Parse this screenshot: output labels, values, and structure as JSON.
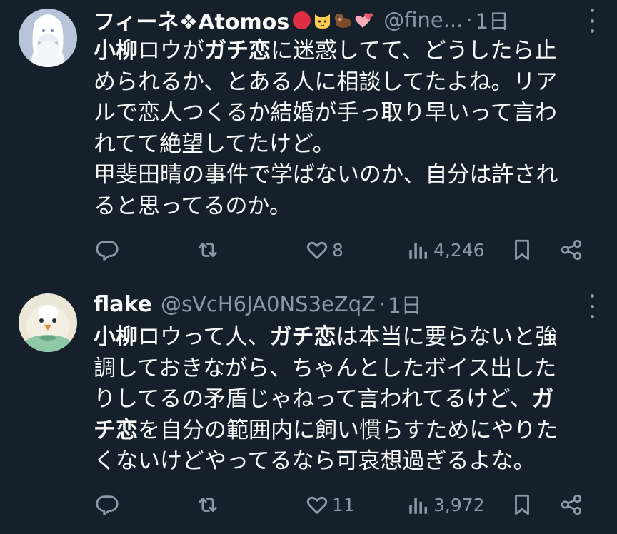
{
  "tweets": [
    {
      "name": "フィーネ❖Atomos",
      "emojis": [
        "red-circle-emoji",
        "cat-face-emoji",
        "otter-emoji",
        "two-hearts-emoji"
      ],
      "handle": "@fine...",
      "separator": "·",
      "time": "1日",
      "lines": [
        [
          {
            "t": "小柳",
            "b": true
          },
          {
            "t": "ロウが",
            "b": false
          },
          {
            "t": "ガチ恋",
            "b": true
          },
          {
            "t": "に迷惑してて、どうしたら止",
            "b": false
          }
        ],
        [
          {
            "t": "められるか、とある人に相談してたよね。リア",
            "b": false
          }
        ],
        [
          {
            "t": "ルで恋人つくるか結婚が手っ取り早いって言わ",
            "b": false
          }
        ],
        [
          {
            "t": "れてて絶望してたけど。",
            "b": false
          }
        ],
        [
          {
            "t": "甲斐田晴の事件で学ばないのか、自分は許され",
            "b": false
          }
        ],
        [
          {
            "t": "ると思ってるのか。",
            "b": false
          }
        ]
      ],
      "likes": "8",
      "views": "4,246",
      "colors": {
        "avatar_bg": "#c9d3e4"
      }
    },
    {
      "name": "flake",
      "emojis": [],
      "handle": "@sVcH6JA0NS3eZqZ",
      "separator": "·",
      "time": "1日",
      "lines": [
        [
          {
            "t": "小柳",
            "b": true
          },
          {
            "t": "ロウって人、",
            "b": false
          },
          {
            "t": "ガチ恋",
            "b": true
          },
          {
            "t": "は本当に要らないと強",
            "b": false
          }
        ],
        [
          {
            "t": "調しておきながら、ちゃんとしたボイス出した",
            "b": false
          }
        ],
        [
          {
            "t": "りしてるの矛盾じゃねって言われてるけど、",
            "b": false
          },
          {
            "t": "ガ",
            "b": true
          }
        ],
        [
          {
            "t": "チ恋",
            "b": true
          },
          {
            "t": "を自分の範囲内に飼い慣らすためにやりた",
            "b": false
          }
        ],
        [
          {
            "t": "くないけどやってるなら可哀想過ぎるよな。",
            "b": false
          }
        ]
      ],
      "likes": "11",
      "views": "3,972",
      "colors": {
        "avatar_bg": "#e6dfcf"
      }
    }
  ],
  "colors": {
    "background": "#15202b",
    "text": "#f7f9f9",
    "secondary": "#8b98a5",
    "divider": "#38444d"
  }
}
